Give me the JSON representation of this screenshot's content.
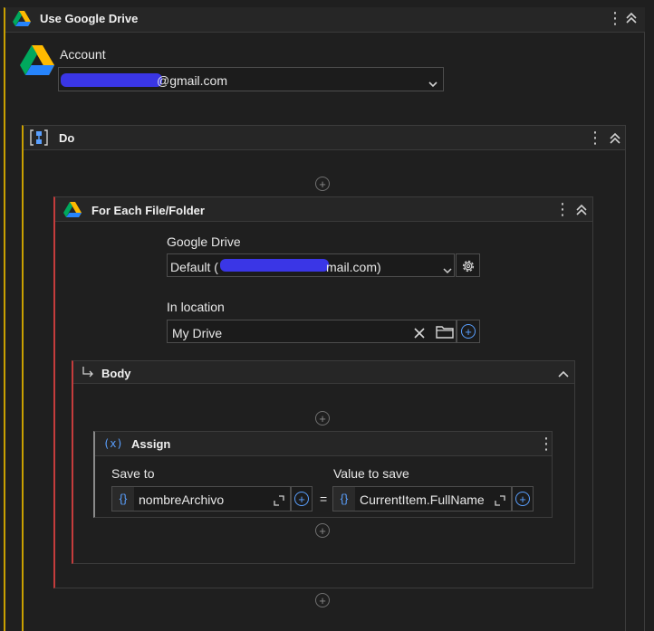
{
  "outer": {
    "title": "Use Google Drive",
    "account_label": "Account",
    "account_value": "@gmail.com"
  },
  "do_block": {
    "title": "Do"
  },
  "foreach": {
    "title": "For Each File/Folder",
    "drive_label": "Google Drive",
    "drive_prefix": "Default (",
    "drive_suffix": "mail.com)",
    "location_label": "In location",
    "location_value": "My Drive"
  },
  "body_block": {
    "title": "Body"
  },
  "assign": {
    "icon_text": "(x)",
    "title": "Assign",
    "save_to_label": "Save to",
    "save_to_value": "nombreArchivo",
    "equals": "=",
    "value_label": "Value to save",
    "value_value": "CurrentItem.FullName",
    "brace": "{}"
  },
  "colors": {
    "accent_yellow": "#c9a000",
    "accent_red": "#c43c3c",
    "accent_blue": "#5aa0ff"
  }
}
